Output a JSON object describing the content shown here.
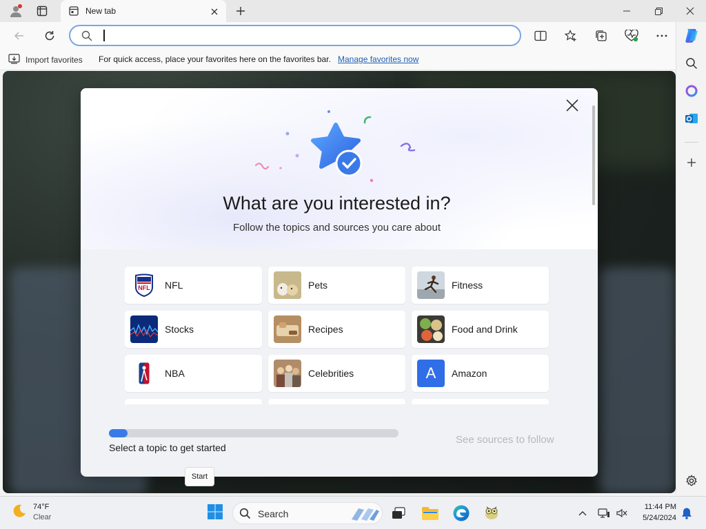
{
  "browser": {
    "tab": {
      "title": "New tab"
    },
    "address_bar": {
      "value": "",
      "placeholder": ""
    },
    "favorites_bar": {
      "import_label": "Import favorites",
      "hint": "For quick access, place your favorites here on the favorites bar.",
      "manage_link": "Manage favorites now"
    }
  },
  "modal": {
    "title": "What are you interested in?",
    "subtitle": "Follow the topics and sources you care about",
    "topics": [
      {
        "label": "NFL",
        "icon": "nfl-logo"
      },
      {
        "label": "Pets",
        "icon": "pets-thumbnail"
      },
      {
        "label": "Fitness",
        "icon": "fitness-thumbnail"
      },
      {
        "label": "Stocks",
        "icon": "stocks-thumbnail"
      },
      {
        "label": "Recipes",
        "icon": "recipes-thumbnail"
      },
      {
        "label": "Food and Drink",
        "icon": "food-thumbnail"
      },
      {
        "label": "NBA",
        "icon": "nba-logo"
      },
      {
        "label": "Celebrities",
        "icon": "celebrities-thumbnail"
      },
      {
        "label": "Amazon",
        "icon": "amazon-letter-a",
        "letter": "A"
      }
    ],
    "progress": {
      "fraction": 0.065,
      "label": "Select a topic to get started"
    },
    "see_sources_label": "See sources to follow"
  },
  "tooltip": {
    "text": "Start"
  },
  "taskbar": {
    "weather": {
      "temp": "74°F",
      "condition": "Clear"
    },
    "search_label": "Search",
    "clock": {
      "time": "11:44 PM",
      "date": "5/24/2024"
    }
  },
  "colors": {
    "accent": "#3a7ae8",
    "link": "#1a5fb4",
    "amazon_tile": "#2f6ee6",
    "disabled_text": "#b6b8be"
  }
}
